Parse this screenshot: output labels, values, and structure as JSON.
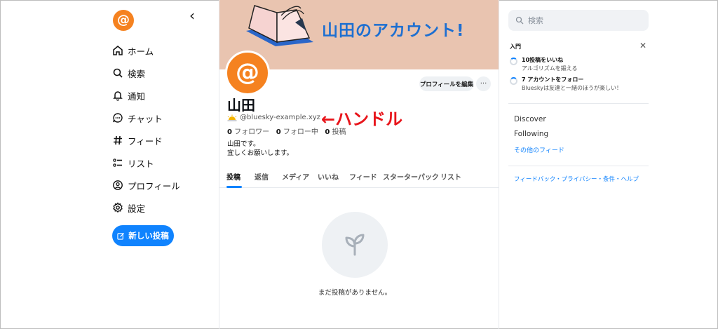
{
  "colors": {
    "accent": "#1083fe",
    "avatar": "#f58220",
    "banner_bg": "#e9c4b0",
    "banner_text": "#1d6fd1",
    "annotation": "#e8151b"
  },
  "sidebar": {
    "logo_glyph": "@",
    "back_glyph": "‹",
    "items": [
      {
        "icon": "home-icon",
        "label": "ホーム"
      },
      {
        "icon": "search-icon",
        "label": "検索"
      },
      {
        "icon": "bell-icon",
        "label": "通知"
      },
      {
        "icon": "chat-icon",
        "label": "チャット"
      },
      {
        "icon": "hash-icon",
        "label": "フィード"
      },
      {
        "icon": "list-icon",
        "label": "リスト"
      },
      {
        "icon": "profile-icon",
        "label": "プロフィール"
      },
      {
        "icon": "gear-icon",
        "label": "設定"
      }
    ],
    "new_post_label": "新しい投稿"
  },
  "profile": {
    "banner_title": "山田のアカウント!",
    "avatar_glyph": "@",
    "edit_label": "プロフィールを編集",
    "more_label": "···",
    "name": "山田",
    "handle": "@bluesky-example.xyz",
    "annotation": "←ハンドル",
    "stats": {
      "followers_count": "0",
      "followers_label": "フォロワー",
      "following_count": "0",
      "following_label": "フォロー中",
      "posts_count": "0",
      "posts_label": "投稿"
    },
    "bio_line1": "山田です。",
    "bio_line2": "宜しくお願いします。"
  },
  "tabs": [
    "投稿",
    "返信",
    "メディア",
    "いいね",
    "フィード",
    "スターターパック",
    "リスト"
  ],
  "empty_state": "まだ投稿がありません。",
  "right": {
    "search_placeholder": "検索",
    "intro_title": "入門",
    "close_glyph": "✕",
    "tasks": [
      {
        "title": "10投稿をいいね",
        "subtitle": "アルゴリズムを鍛える"
      },
      {
        "title": "7 アカウントをフォロー",
        "subtitle": "Blueskyは友達と一緒のほうが楽しい！"
      }
    ],
    "feeds": [
      "Discover",
      "Following"
    ],
    "more_feeds": "その他のフィード",
    "footer": "フィードバック・プライバシー・条件・ヘルプ"
  }
}
